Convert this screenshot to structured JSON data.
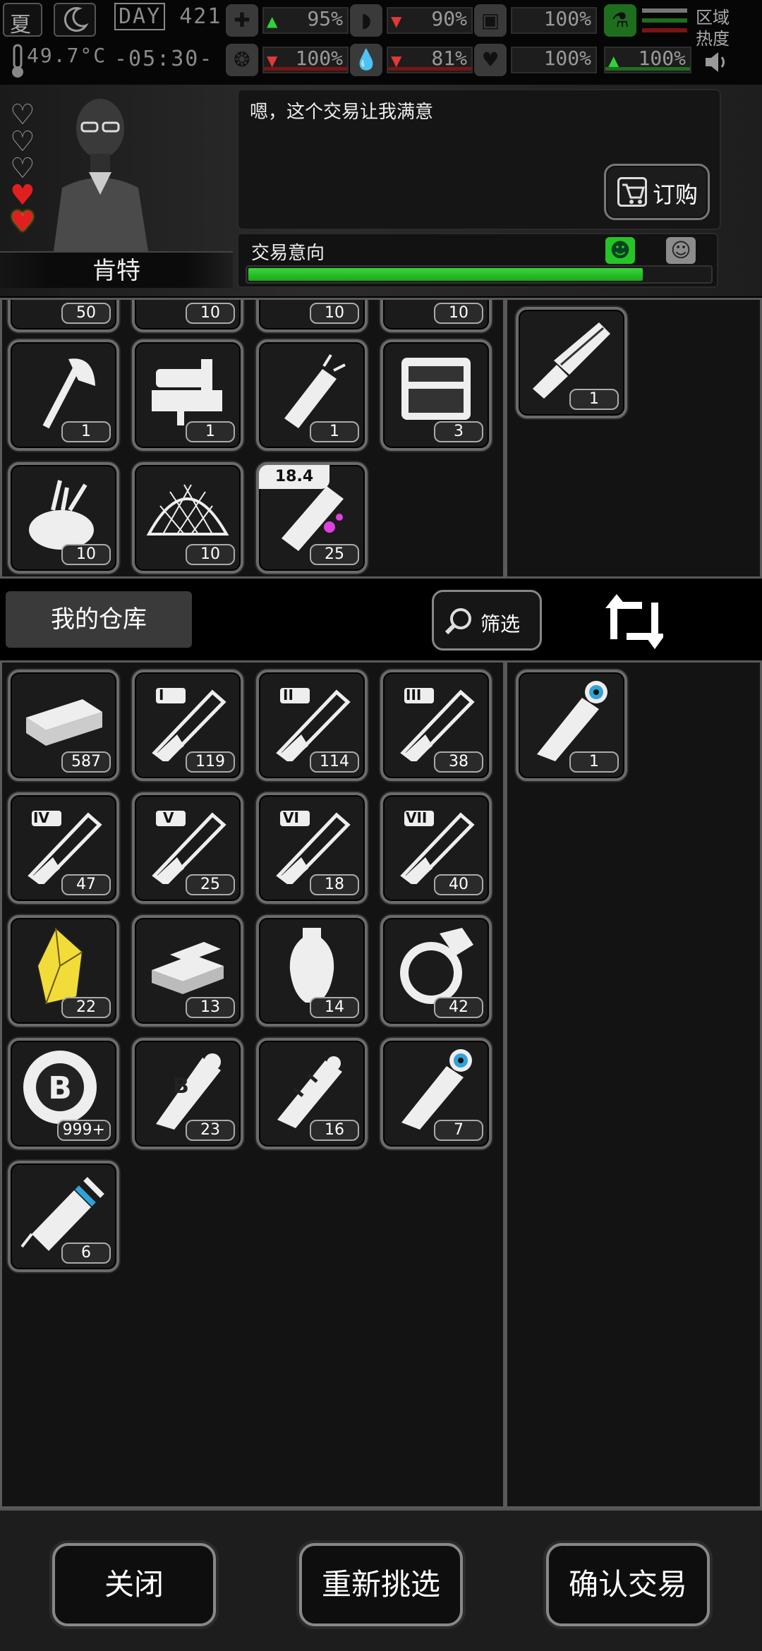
{
  "status_bar": {
    "season": "夏",
    "day_label": "DAY",
    "day_number": "421",
    "temperature": "49.7°C",
    "time": "-05:30-",
    "region_heat_label": "区域热度",
    "stats": [
      {
        "name": "health",
        "icon": "medkit-icon",
        "arrow": "up",
        "value": "95%"
      },
      {
        "name": "hunger",
        "icon": "stomach-icon",
        "arrow": "down",
        "value": "90%"
      },
      {
        "name": "armor",
        "icon": "vest-icon",
        "arrow": "",
        "value": "100%"
      },
      {
        "name": "mood",
        "icon": "brain-icon",
        "arrow": "down",
        "value": "100%"
      },
      {
        "name": "thirst",
        "icon": "water-drop-icon",
        "arrow": "down",
        "value": "81%"
      },
      {
        "name": "heart",
        "icon": "heart-icon",
        "arrow": "",
        "value": "100%"
      },
      {
        "name": "stamina",
        "icon": "flask-icon",
        "arrow": "up",
        "value": "100%"
      }
    ]
  },
  "trader": {
    "name": "肯特",
    "hearts_total": 5,
    "hearts_filled": 2,
    "dialog": "嗯，这个交易让我满意",
    "order_button": "订购",
    "willingness_label": "交易意向",
    "willingness": 0.85
  },
  "merchant_items": [
    {
      "icon": "item-icon",
      "count": "50"
    },
    {
      "icon": "item-icon",
      "count": "10"
    },
    {
      "icon": "item-icon",
      "count": "10"
    },
    {
      "icon": "item-icon",
      "count": "10"
    },
    {
      "icon": "fire-axe-icon",
      "count": "1"
    },
    {
      "icon": "sewing-machine-icon",
      "count": "1"
    },
    {
      "icon": "flashlight-icon",
      "count": "1"
    },
    {
      "icon": "toolbox-icon",
      "count": "3"
    },
    {
      "icon": "tool-bag-icon",
      "count": "10"
    },
    {
      "icon": "net-icon",
      "count": "10"
    },
    {
      "icon": "spray-can-icon",
      "count": "25",
      "weight": "18.4"
    }
  ],
  "merchant_offer": [
    {
      "icon": "minigun-icon",
      "count": "1"
    }
  ],
  "warehouse": {
    "title": "我的仓库",
    "filter_label": "筛选",
    "items": [
      {
        "icon": "cash-stack-icon",
        "count": "587"
      },
      {
        "icon": "test-tube-i-icon",
        "count": "119",
        "roman": "I"
      },
      {
        "icon": "test-tube-ii-icon",
        "count": "114",
        "roman": "II"
      },
      {
        "icon": "test-tube-iii-icon",
        "count": "38",
        "roman": "III"
      },
      {
        "icon": "test-tube-iv-icon",
        "count": "47",
        "roman": "IV"
      },
      {
        "icon": "test-tube-v-icon",
        "count": "25",
        "roman": "V"
      },
      {
        "icon": "test-tube-vi-icon",
        "count": "18",
        "roman": "VI"
      },
      {
        "icon": "test-tube-vii-icon",
        "count": "40",
        "roman": "VII"
      },
      {
        "icon": "gold-crystal-icon",
        "count": "22"
      },
      {
        "icon": "gold-bars-icon",
        "count": "13"
      },
      {
        "icon": "vase-icon",
        "count": "14"
      },
      {
        "icon": "diamond-ring-icon",
        "count": "42"
      },
      {
        "icon": "bitcoin-chip-icon",
        "count": "999+"
      },
      {
        "icon": "robot-arm-b-icon",
        "count": "23"
      },
      {
        "icon": "robot-arm-broken-icon",
        "count": "16"
      },
      {
        "icon": "robot-arm-eye-icon",
        "count": "7"
      },
      {
        "icon": "syringe-icon",
        "count": "6"
      }
    ]
  },
  "player_offer": [
    {
      "icon": "robot-arm-eye-icon",
      "count": "1"
    }
  ],
  "buttons": {
    "close": "关闭",
    "reselect": "重新挑选",
    "confirm": "确认交易"
  },
  "colors": {
    "willingness_bar": "#22c022",
    "crystal": "#f2dc3a",
    "eye": "#2fa3d8",
    "spray_accent": "#e040e0"
  }
}
